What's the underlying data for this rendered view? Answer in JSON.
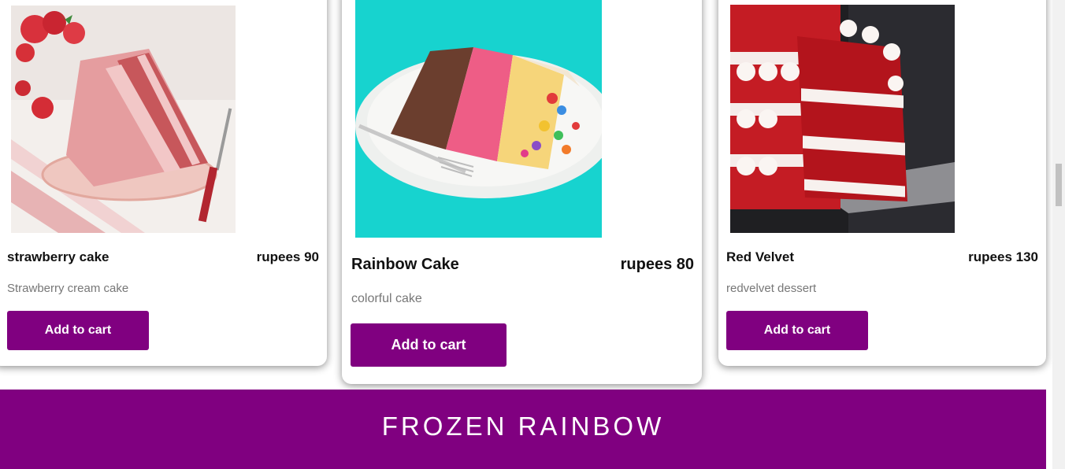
{
  "products": [
    {
      "name": "strawberry cake",
      "price": "rupees 90",
      "description": "Strawberry cream cake",
      "button_label": "Add to cart"
    },
    {
      "name": "Rainbow Cake",
      "price": "rupees 80",
      "description": "colorful cake",
      "button_label": "Add to cart"
    },
    {
      "name": "Red Velvet",
      "price": "rupees 130",
      "description": "redvelvet dessert",
      "button_label": "Add to cart"
    }
  ],
  "banner": {
    "title": "FROZEN RAINBOW"
  },
  "colors": {
    "accent": "#800080",
    "button_text": "#ffffff",
    "description_text": "#777777"
  }
}
